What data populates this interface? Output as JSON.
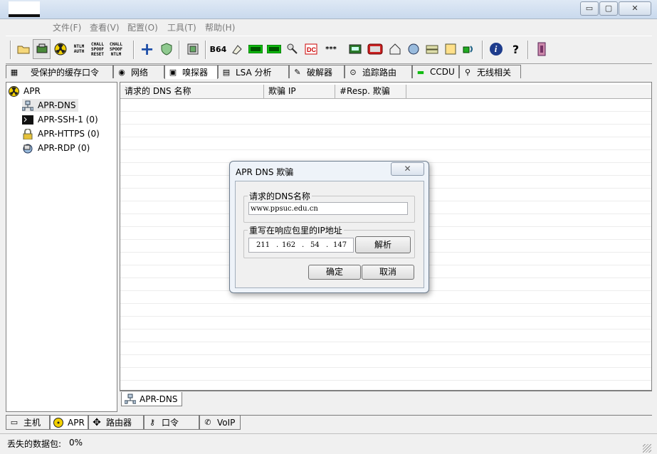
{
  "window": {
    "minimize_glyph": "▭",
    "maximize_glyph": "▢",
    "close_glyph": "✕"
  },
  "menu": [
    "文件(F)",
    "查看(V)",
    "配置(O)",
    "工具(T)",
    "帮助(H)"
  ],
  "toolbar": {
    "ntlm_auth": "NTLM AUTH",
    "chall_spoof_reset": "CHALL SPOOF RESET",
    "chall_spoof_ntlm": "CHALL SPOOF NTLM",
    "plus": "+",
    "b64": "B64",
    "stars": "***",
    "info": "i",
    "help": "?"
  },
  "tabs": [
    "受保护的缓存口令",
    "网络",
    "嗅探器",
    "LSA 分析",
    "破解器",
    "追踪路由",
    "CCDU",
    "无线相关"
  ],
  "tree": {
    "root": "APR",
    "items": [
      "APR-DNS",
      "APR-SSH-1 (0)",
      "APR-HTTPS (0)",
      "APR-RDP (0)"
    ]
  },
  "list": {
    "columns": [
      "请求的 DNS 名称",
      "欺骗 IP",
      "#Resp. 欺骗"
    ]
  },
  "subtab": "APR-DNS",
  "bottom_tabs": [
    "主机",
    "APR",
    "路由器",
    "口令",
    "VoIP"
  ],
  "status": {
    "label": "丢失的数据包:",
    "value": "0%"
  },
  "dialog": {
    "title": "APR DNS 欺骗",
    "close_glyph": "✕",
    "dns_group_label": "请求的DNS名称",
    "dns_value": "www.ppsuc.edu.cn",
    "ip_group_label": "重写在响应包里的IP地址",
    "ip_octets": [
      "211",
      "162",
      "54",
      "147"
    ],
    "ip_dot": ".",
    "resolve_button": "解析",
    "ok_button": "确定",
    "cancel_button": "取消"
  },
  "colors": {
    "radiation_yellow": "#f2d000",
    "plus_blue": "#1e4ea8"
  }
}
